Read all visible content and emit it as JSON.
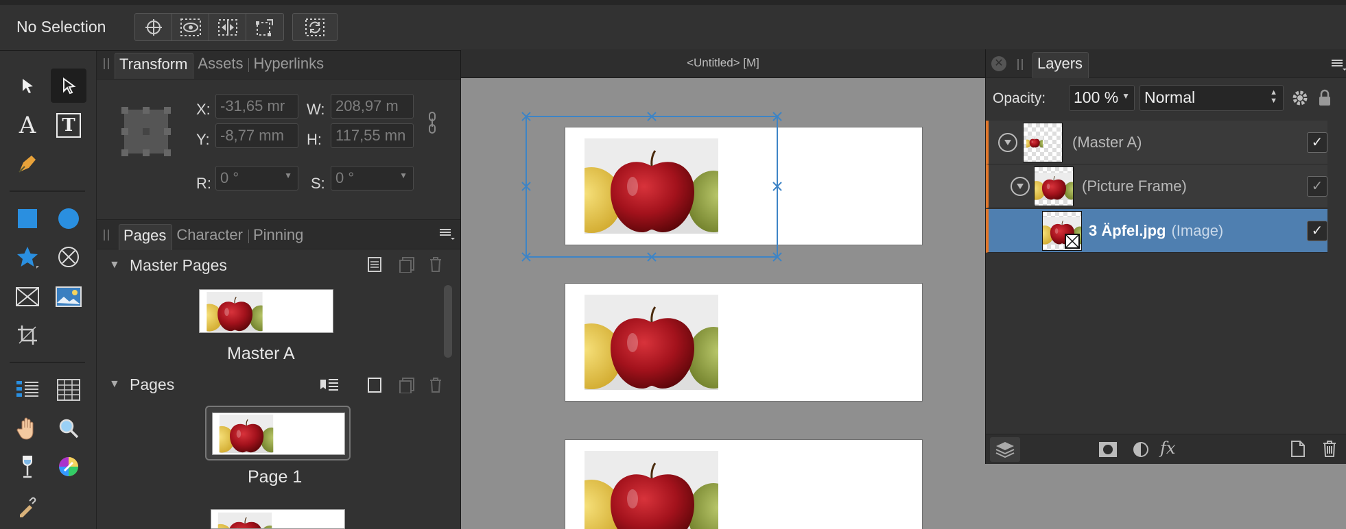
{
  "context": {
    "selection_label": "No Selection"
  },
  "panel_transform": {
    "tabs": [
      "Transform",
      "Assets",
      "Hyperlinks"
    ],
    "x_label": "X:",
    "x_value": "-31,65 mr",
    "y_label": "Y:",
    "y_value": "-8,77 mm",
    "w_label": "W:",
    "w_value": "208,97 m",
    "h_label": "H:",
    "h_value": "117,55 mn",
    "r_label": "R:",
    "r_value": "0 °",
    "s_label": "S:",
    "s_value": "0 °"
  },
  "panel_pages": {
    "tabs": [
      "Pages",
      "Character",
      "Pinning"
    ],
    "master_header": "Master Pages",
    "master_name": "Master A",
    "pages_header": "Pages",
    "page_name": "Page 1"
  },
  "document": {
    "title": "<Untitled> [M]"
  },
  "layers": {
    "tab": "Layers",
    "opacity_label": "Opacity:",
    "opacity_value": "100 %",
    "blend_mode": "Normal",
    "rows": [
      {
        "name": "(Master A)",
        "kind": ""
      },
      {
        "name": "(Picture Frame)",
        "kind": ""
      },
      {
        "name": "3 Äpfel.jpg",
        "kind": "(Image)"
      }
    ],
    "fx_label": "fx"
  },
  "colors": {
    "selection": "#3d84c6",
    "selected_row": "#4f7fb0",
    "accent_orange": "#e0762a"
  }
}
